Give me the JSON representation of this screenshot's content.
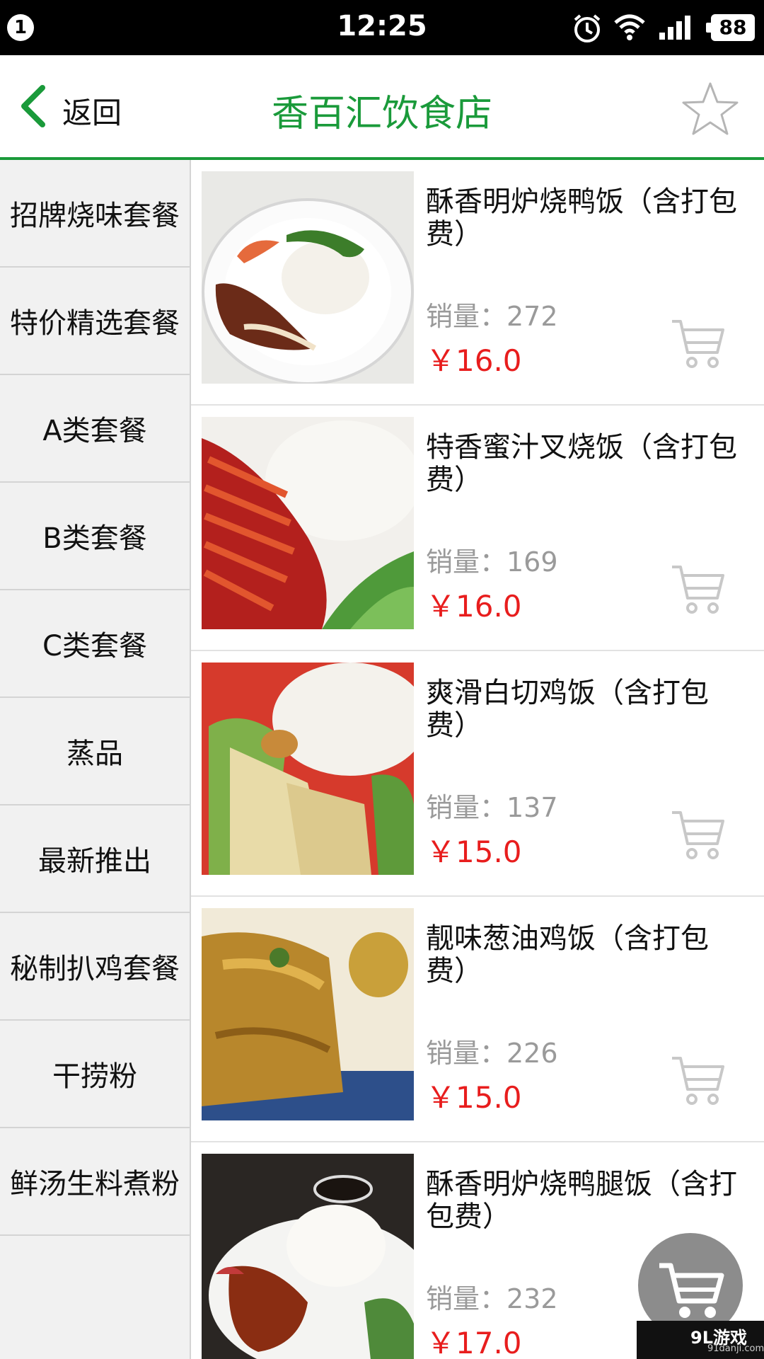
{
  "status_bar": {
    "notification_count": "1",
    "time": "12:25",
    "battery": "88",
    "icons": [
      "alarm-icon",
      "wifi-icon",
      "signal-icon",
      "battery-icon"
    ]
  },
  "header": {
    "back_label": "返回",
    "title": "香百汇饮食店",
    "accent_color": "#1a9a3a"
  },
  "sidebar": {
    "categories": [
      {
        "label": "招牌烧味套餐"
      },
      {
        "label": "特价精选套餐"
      },
      {
        "label": "A类套餐"
      },
      {
        "label": "B类套餐"
      },
      {
        "label": "C类套餐"
      },
      {
        "label": "蒸品"
      },
      {
        "label": "最新推出"
      },
      {
        "label": "秘制扒鸡套餐"
      },
      {
        "label": "干捞粉"
      },
      {
        "label": "鲜汤生料煮粉"
      }
    ]
  },
  "products": [
    {
      "name": "酥香明炉烧鸭饭（含打包费）",
      "sales": "销量：272",
      "price": "￥16.0"
    },
    {
      "name": "特香蜜汁叉烧饭（含打包费）",
      "sales": "销量：169",
      "price": "￥16.0"
    },
    {
      "name": "爽滑白切鸡饭（含打包费）",
      "sales": "销量：137",
      "price": "￥15.0"
    },
    {
      "name": "靓味葱油鸡饭（含打包费）",
      "sales": "销量：226",
      "price": "￥15.0"
    },
    {
      "name": "酥香明炉烧鸭腿饭（含打包费）",
      "sales": "销量：232",
      "price": "￥17.0"
    }
  ],
  "colors": {
    "price": "#e81d1d",
    "sales": "#9a9a9a",
    "sidebar_bg": "#f1f1f1"
  },
  "watermark": {
    "main": "9L游戏",
    "sub": "91danji.com"
  }
}
